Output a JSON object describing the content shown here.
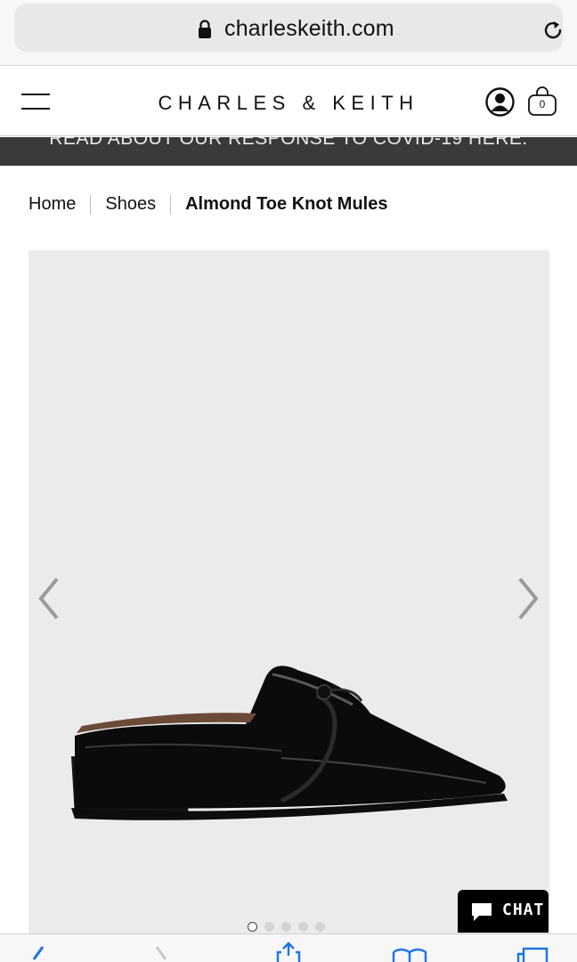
{
  "browser": {
    "url": "charleskeith.com"
  },
  "header": {
    "brand": "CHARLES & KEITH",
    "bag_count": "0"
  },
  "announcement": {
    "text": "READ ABOUT OUR RESPONSE TO COVID-19 HERE."
  },
  "breadcrumb": {
    "items": [
      "Home",
      "Shoes",
      "Almond Toe Knot Mules"
    ]
  },
  "gallery": {
    "image_count": 5,
    "active_index": 0
  },
  "chat": {
    "label": "CHAT"
  },
  "colors": {
    "announce_bg": "#3a3a3a",
    "gallery_bg": "#ebebeb",
    "chat_bg": "#000000",
    "toolbar_icon": "#1a73e8"
  },
  "icons": {
    "lock": "lock-icon",
    "reload": "reload-icon",
    "menu": "hamburger-menu-icon",
    "account": "account-icon",
    "bag": "shopping-bag-icon",
    "prev": "chevron-left-icon",
    "next": "chevron-right-icon",
    "chat": "chat-bubble-icon"
  }
}
